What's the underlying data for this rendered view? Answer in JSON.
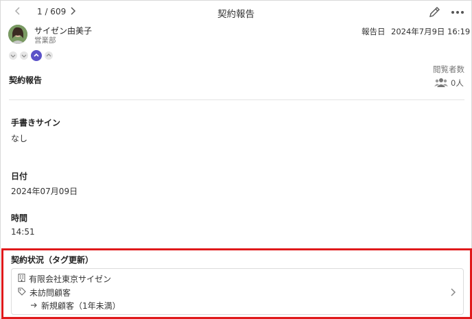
{
  "header": {
    "pager": "1 / 609",
    "title": "契約報告",
    "prev_icon": "chevron-left-icon",
    "next_icon": "chevron-right-icon",
    "edit_icon": "pencil-icon",
    "more_icon": "more-horizontal-icon"
  },
  "author": {
    "name": "サイゼン由美子",
    "department": "営業部"
  },
  "report": {
    "date_label": "報告日",
    "date": "2024年7月9日 16:19",
    "section_title": "契約報告"
  },
  "viewers": {
    "label": "閲覧者数",
    "count": "0人",
    "icon": "users-icon"
  },
  "fields": [
    {
      "label": "手書きサイン",
      "value": "なし"
    },
    {
      "label": "日付",
      "value": "2024年07月09日"
    },
    {
      "label": "時間",
      "value": "14:51"
    }
  ],
  "contract_status": {
    "label": "契約状況（タグ更新）",
    "company": "有限会社東京サイゼン",
    "tag": "未訪問顧客",
    "new_tag": "新規顧客（1年未満）",
    "company_icon": "building-icon",
    "tag_icon": "tag-icon",
    "arrow_icon": "arrow-right-icon"
  },
  "colors": {
    "highlight": "#e0191b",
    "accent": "#5b52c8"
  }
}
